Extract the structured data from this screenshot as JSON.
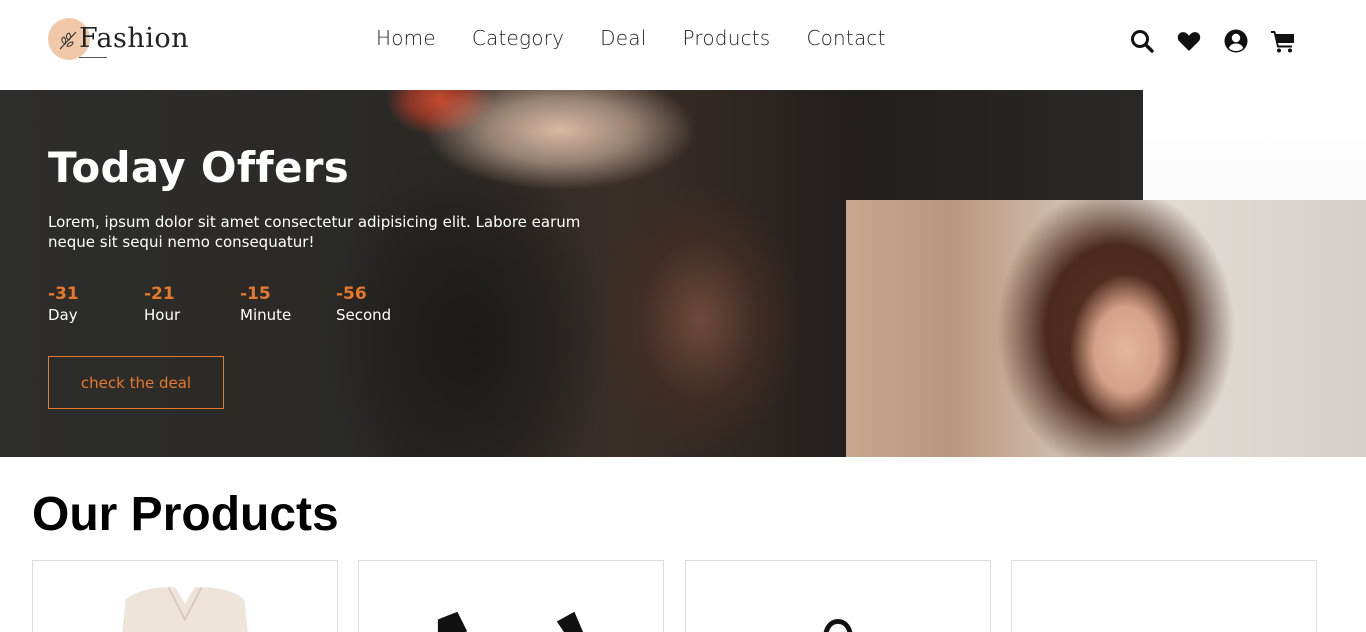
{
  "header": {
    "logo_text": "Fashion",
    "nav": [
      {
        "label": "Home"
      },
      {
        "label": "Category"
      },
      {
        "label": "Deal"
      },
      {
        "label": "Products"
      },
      {
        "label": "Contact"
      }
    ],
    "icons": [
      "search-icon",
      "heart-icon",
      "user-circle-icon",
      "cart-icon"
    ]
  },
  "hero": {
    "title": "Today Offers",
    "description": "Lorem, ipsum dolor sit amet consectetur adipisicing elit. Labore earum neque sit sequi nemo consequatur!",
    "countdown": [
      {
        "value": "-31",
        "label": "Day"
      },
      {
        "value": "-21",
        "label": "Hour"
      },
      {
        "value": "-15",
        "label": "Minute"
      },
      {
        "value": "-56",
        "label": "Second"
      }
    ],
    "cta_label": "check the deal"
  },
  "products": {
    "title": "Our Products",
    "items": [
      {
        "image": "blazer-image"
      },
      {
        "image": "black-top-image"
      },
      {
        "image": "bag-image"
      },
      {
        "image": "product-image"
      }
    ]
  },
  "colors": {
    "accent": "#e8782a",
    "logo_circle": "#f2c9a8"
  }
}
